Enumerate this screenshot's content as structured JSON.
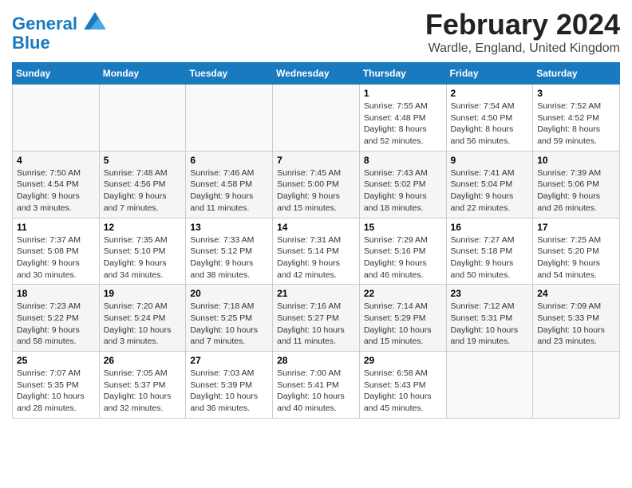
{
  "logo": {
    "line1": "General",
    "line2": "Blue"
  },
  "title": "February 2024",
  "subtitle": "Wardle, England, United Kingdom",
  "days_header": [
    "Sunday",
    "Monday",
    "Tuesday",
    "Wednesday",
    "Thursday",
    "Friday",
    "Saturday"
  ],
  "weeks": [
    [
      {
        "day": "",
        "info": ""
      },
      {
        "day": "",
        "info": ""
      },
      {
        "day": "",
        "info": ""
      },
      {
        "day": "",
        "info": ""
      },
      {
        "day": "1",
        "info": "Sunrise: 7:55 AM\nSunset: 4:48 PM\nDaylight: 8 hours\nand 52 minutes."
      },
      {
        "day": "2",
        "info": "Sunrise: 7:54 AM\nSunset: 4:50 PM\nDaylight: 8 hours\nand 56 minutes."
      },
      {
        "day": "3",
        "info": "Sunrise: 7:52 AM\nSunset: 4:52 PM\nDaylight: 8 hours\nand 59 minutes."
      }
    ],
    [
      {
        "day": "4",
        "info": "Sunrise: 7:50 AM\nSunset: 4:54 PM\nDaylight: 9 hours\nand 3 minutes."
      },
      {
        "day": "5",
        "info": "Sunrise: 7:48 AM\nSunset: 4:56 PM\nDaylight: 9 hours\nand 7 minutes."
      },
      {
        "day": "6",
        "info": "Sunrise: 7:46 AM\nSunset: 4:58 PM\nDaylight: 9 hours\nand 11 minutes."
      },
      {
        "day": "7",
        "info": "Sunrise: 7:45 AM\nSunset: 5:00 PM\nDaylight: 9 hours\nand 15 minutes."
      },
      {
        "day": "8",
        "info": "Sunrise: 7:43 AM\nSunset: 5:02 PM\nDaylight: 9 hours\nand 18 minutes."
      },
      {
        "day": "9",
        "info": "Sunrise: 7:41 AM\nSunset: 5:04 PM\nDaylight: 9 hours\nand 22 minutes."
      },
      {
        "day": "10",
        "info": "Sunrise: 7:39 AM\nSunset: 5:06 PM\nDaylight: 9 hours\nand 26 minutes."
      }
    ],
    [
      {
        "day": "11",
        "info": "Sunrise: 7:37 AM\nSunset: 5:08 PM\nDaylight: 9 hours\nand 30 minutes."
      },
      {
        "day": "12",
        "info": "Sunrise: 7:35 AM\nSunset: 5:10 PM\nDaylight: 9 hours\nand 34 minutes."
      },
      {
        "day": "13",
        "info": "Sunrise: 7:33 AM\nSunset: 5:12 PM\nDaylight: 9 hours\nand 38 minutes."
      },
      {
        "day": "14",
        "info": "Sunrise: 7:31 AM\nSunset: 5:14 PM\nDaylight: 9 hours\nand 42 minutes."
      },
      {
        "day": "15",
        "info": "Sunrise: 7:29 AM\nSunset: 5:16 PM\nDaylight: 9 hours\nand 46 minutes."
      },
      {
        "day": "16",
        "info": "Sunrise: 7:27 AM\nSunset: 5:18 PM\nDaylight: 9 hours\nand 50 minutes."
      },
      {
        "day": "17",
        "info": "Sunrise: 7:25 AM\nSunset: 5:20 PM\nDaylight: 9 hours\nand 54 minutes."
      }
    ],
    [
      {
        "day": "18",
        "info": "Sunrise: 7:23 AM\nSunset: 5:22 PM\nDaylight: 9 hours\nand 58 minutes."
      },
      {
        "day": "19",
        "info": "Sunrise: 7:20 AM\nSunset: 5:24 PM\nDaylight: 10 hours\nand 3 minutes."
      },
      {
        "day": "20",
        "info": "Sunrise: 7:18 AM\nSunset: 5:25 PM\nDaylight: 10 hours\nand 7 minutes."
      },
      {
        "day": "21",
        "info": "Sunrise: 7:16 AM\nSunset: 5:27 PM\nDaylight: 10 hours\nand 11 minutes."
      },
      {
        "day": "22",
        "info": "Sunrise: 7:14 AM\nSunset: 5:29 PM\nDaylight: 10 hours\nand 15 minutes."
      },
      {
        "day": "23",
        "info": "Sunrise: 7:12 AM\nSunset: 5:31 PM\nDaylight: 10 hours\nand 19 minutes."
      },
      {
        "day": "24",
        "info": "Sunrise: 7:09 AM\nSunset: 5:33 PM\nDaylight: 10 hours\nand 23 minutes."
      }
    ],
    [
      {
        "day": "25",
        "info": "Sunrise: 7:07 AM\nSunset: 5:35 PM\nDaylight: 10 hours\nand 28 minutes."
      },
      {
        "day": "26",
        "info": "Sunrise: 7:05 AM\nSunset: 5:37 PM\nDaylight: 10 hours\nand 32 minutes."
      },
      {
        "day": "27",
        "info": "Sunrise: 7:03 AM\nSunset: 5:39 PM\nDaylight: 10 hours\nand 36 minutes."
      },
      {
        "day": "28",
        "info": "Sunrise: 7:00 AM\nSunset: 5:41 PM\nDaylight: 10 hours\nand 40 minutes."
      },
      {
        "day": "29",
        "info": "Sunrise: 6:58 AM\nSunset: 5:43 PM\nDaylight: 10 hours\nand 45 minutes."
      },
      {
        "day": "",
        "info": ""
      },
      {
        "day": "",
        "info": ""
      }
    ]
  ]
}
